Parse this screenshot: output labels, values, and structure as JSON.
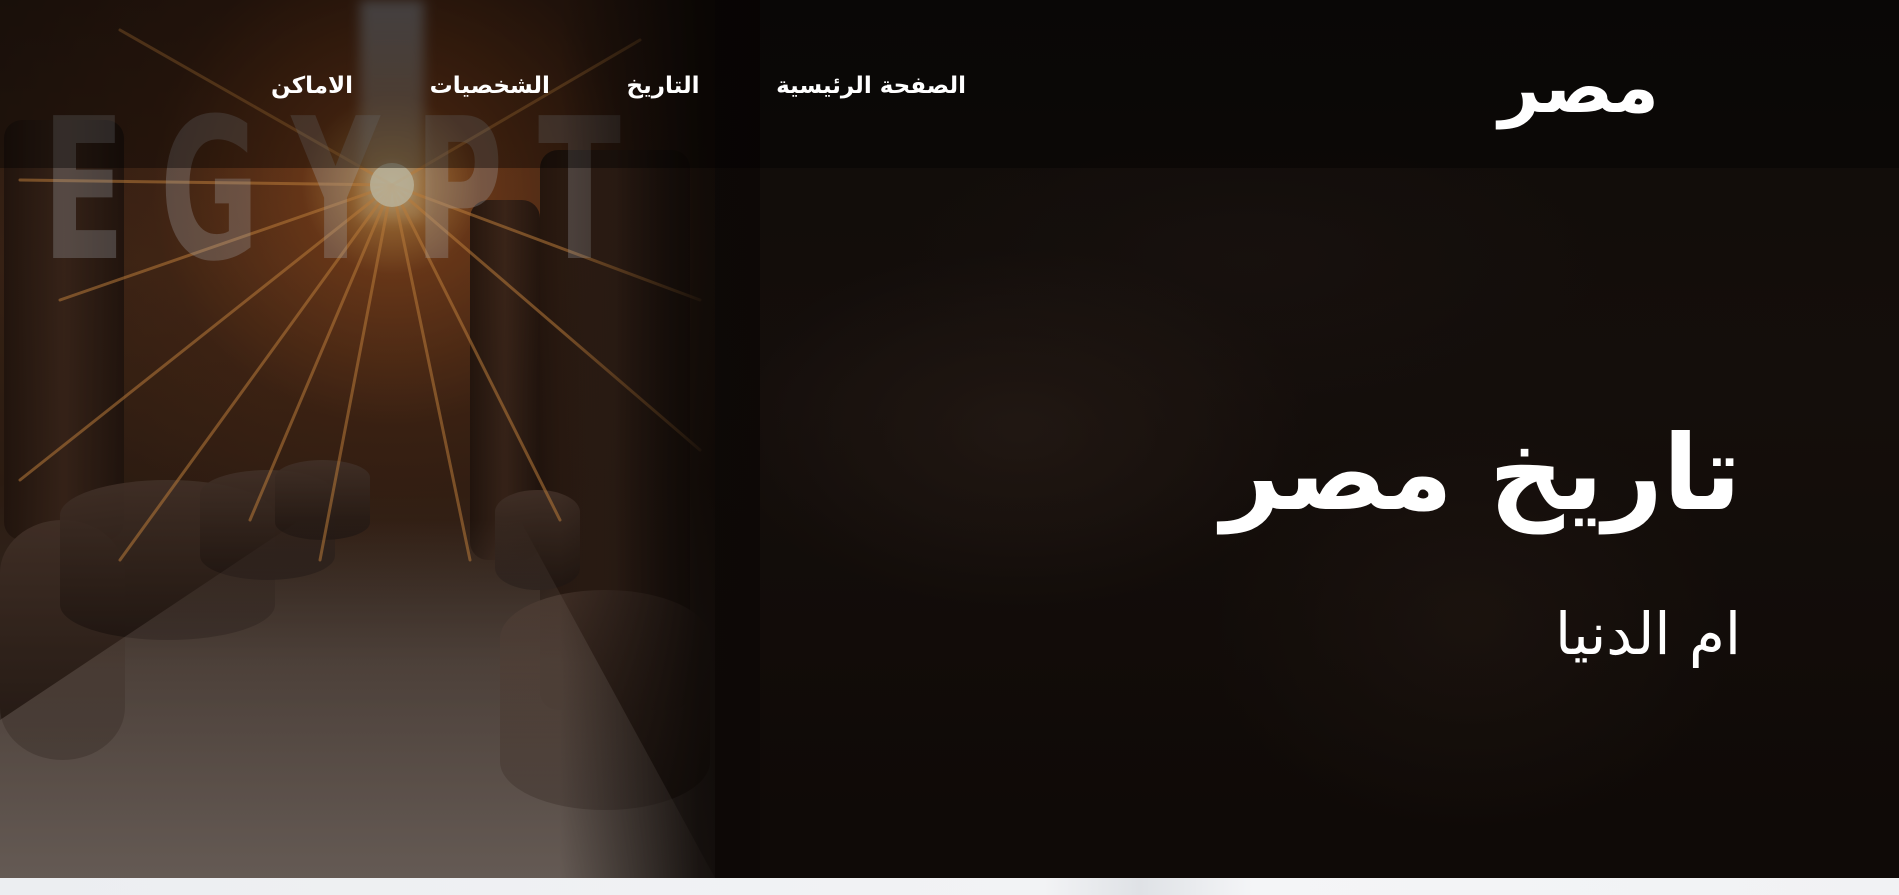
{
  "brand": {
    "logo_text": "مصر"
  },
  "nav": {
    "items": [
      {
        "label": "الصفحة الرئيسية"
      },
      {
        "label": "التاريخ"
      },
      {
        "label": "الشخصيات"
      },
      {
        "label": "الاماكن"
      }
    ]
  },
  "hero": {
    "background_watermark": "EGYPT",
    "title": "تاريخ مصر",
    "subtitle": "ام الدنيا"
  },
  "colors": {
    "text": "#ffffff",
    "header_overlay": "#000000",
    "background_dark": "#120c09",
    "sun_glow": "#ffb054"
  }
}
